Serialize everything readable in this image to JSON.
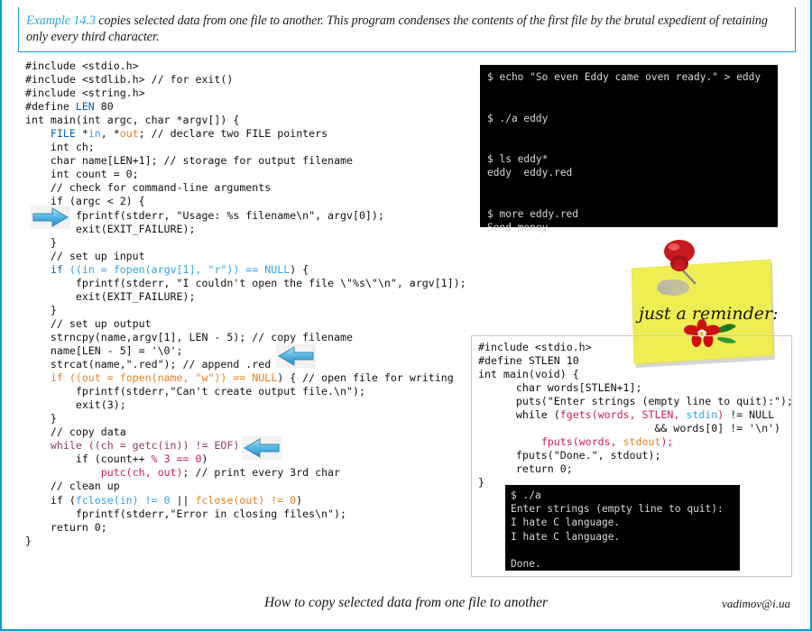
{
  "header": {
    "example_label": "Example 14.3",
    "body_text": " copies selected data from one file to another. This program condenses the contents of the first file by the brutal expedient of retaining only every third character."
  },
  "code_main": {
    "lines": [
      [
        {
          "t": "#include <stdio.h>",
          "c": "plain"
        }
      ],
      [
        {
          "t": "#include <stdlib.h> ",
          "c": "plain"
        },
        {
          "t": "// for exit()",
          "c": "plain"
        }
      ],
      [
        {
          "t": "#include <string.h>",
          "c": "plain"
        }
      ],
      [
        {
          "t": "#define ",
          "c": "plain"
        },
        {
          "t": "LEN",
          "c": "key"
        },
        {
          "t": " 80",
          "c": "plain"
        }
      ],
      [
        {
          "t": "int main(int argc, char *argv[]) {",
          "c": "plain"
        }
      ],
      [
        {
          "t": "    ",
          "c": "plain"
        },
        {
          "t": "FILE",
          "c": "key"
        },
        {
          "t": " *",
          "c": "plain"
        },
        {
          "t": "in",
          "c": "lblue"
        },
        {
          "t": ", *",
          "c": "plain"
        },
        {
          "t": "out",
          "c": "orange"
        },
        {
          "t": "; // declare two FILE pointers",
          "c": "plain"
        }
      ],
      [
        {
          "t": "    int ch;",
          "c": "plain"
        }
      ],
      [
        {
          "t": "    char name[LEN+1]; // storage for output filename",
          "c": "plain"
        }
      ],
      [
        {
          "t": "    int count = 0;",
          "c": "plain"
        }
      ],
      [
        {
          "t": "    // check for command-line arguments",
          "c": "plain"
        }
      ],
      [
        {
          "t": "    if (argc < 2) {",
          "c": "plain"
        }
      ],
      [
        {
          "t": "        fprintf(stderr, \"Usage: %s filename\\n\", argv[0]);",
          "c": "plain"
        }
      ],
      [
        {
          "t": "        exit(EXIT_FAILURE);",
          "c": "plain"
        }
      ],
      [
        {
          "t": "    }",
          "c": "plain"
        }
      ],
      [
        {
          "t": "    // set up input",
          "c": "plain"
        }
      ],
      [
        {
          "t": "    ",
          "c": "plain"
        },
        {
          "t": "if",
          "c": "key"
        },
        {
          "t": " ((",
          "c": "lblue"
        },
        {
          "t": "in",
          "c": "lblue"
        },
        {
          "t": " = ",
          "c": "lblue"
        },
        {
          "t": "fopen(argv[1], \"r\")) == NULL",
          "c": "lblue"
        },
        {
          "t": ") {",
          "c": "plain"
        }
      ],
      [
        {
          "t": "        fprintf(stderr, \"I couldn't open the file \\\"%s\\\"\\n\", argv[1]);",
          "c": "plain"
        }
      ],
      [
        {
          "t": "        exit(EXIT_FAILURE);",
          "c": "plain"
        }
      ],
      [
        {
          "t": "    }",
          "c": "plain"
        }
      ],
      [
        {
          "t": "    // set up output",
          "c": "plain"
        }
      ],
      [
        {
          "t": "    strncpy(name,argv[1], LEN - 5); // copy filename",
          "c": "plain"
        }
      ],
      [
        {
          "t": "    name[LEN - 5] = '\\0';",
          "c": "plain"
        }
      ],
      [
        {
          "t": "    strcat(name,\".red\"); // append .red",
          "c": "plain"
        }
      ],
      [
        {
          "t": "    ",
          "c": "plain"
        },
        {
          "t": "if ((",
          "c": "orange"
        },
        {
          "t": "out",
          "c": "orange"
        },
        {
          "t": " = fopen(name, \"w\")) == NULL",
          "c": "orange"
        },
        {
          "t": ") { // open file for writing",
          "c": "plain"
        }
      ],
      [
        {
          "t": "        fprintf(stderr,\"Can't create output file.\\n\");",
          "c": "plain"
        }
      ],
      [
        {
          "t": "        exit(3);",
          "c": "plain"
        }
      ],
      [
        {
          "t": "    }",
          "c": "plain"
        }
      ],
      [
        {
          "t": "    // copy data",
          "c": "plain"
        }
      ],
      [
        {
          "t": "    ",
          "c": "plain"
        },
        {
          "t": "while ((ch = getc(in)) != EOF)",
          "c": "purple"
        }
      ],
      [
        {
          "t": "        if (count++ ",
          "c": "plain"
        },
        {
          "t": "% 3 == 0",
          "c": "pink"
        },
        {
          "t": ")",
          "c": "plain"
        }
      ],
      [
        {
          "t": "            ",
          "c": "plain"
        },
        {
          "t": "putc(ch, out)",
          "c": "pink"
        },
        {
          "t": "; // print every 3rd char",
          "c": "plain"
        }
      ],
      [
        {
          "t": "    // clean up",
          "c": "plain"
        }
      ],
      [
        {
          "t": "    if (",
          "c": "plain"
        },
        {
          "t": "fclose(in) != 0",
          "c": "lblue"
        },
        {
          "t": " || ",
          "c": "plain"
        },
        {
          "t": "fclose(out) != 0",
          "c": "orange"
        },
        {
          "t": ")",
          "c": "plain"
        }
      ],
      [
        {
          "t": "        fprintf(stderr,\"Error in closing files\\n\");",
          "c": "plain"
        }
      ],
      [
        {
          "t": "    return 0;",
          "c": "plain"
        }
      ],
      [
        {
          "t": "}",
          "c": "plain"
        }
      ]
    ]
  },
  "terminal_1": {
    "lines": [
      "$ echo \"So even Eddy came oven ready.\" > eddy",
      "",
      "",
      "$ ./a eddy",
      "",
      "",
      "$ ls eddy*",
      "eddy  eddy.red",
      "",
      "",
      "$ more eddy.red",
      "Send money"
    ]
  },
  "sticky_note": {
    "text": "just a reminder:"
  },
  "code_2": {
    "lines": [
      [
        {
          "t": "#include <stdio.h>",
          "c": "plain"
        }
      ],
      [
        {
          "t": "#define STLEN 10",
          "c": "plain"
        }
      ],
      [
        {
          "t": "int main(void) {",
          "c": "plain"
        }
      ],
      [
        {
          "t": "      char words[STLEN+1];",
          "c": "plain"
        }
      ],
      [
        {
          "t": "      puts(\"Enter strings (empty line to quit):\");",
          "c": "plain"
        }
      ],
      [
        {
          "t": "      while (",
          "c": "plain"
        },
        {
          "t": "fgets(words, STLEN, ",
          "c": "pink"
        },
        {
          "t": "stdin",
          "c": "lblue"
        },
        {
          "t": ")",
          "c": "pink"
        },
        {
          "t": " != NULL",
          "c": "plain"
        }
      ],
      [
        {
          "t": "                            && words[0] != '\\n')",
          "c": "plain"
        }
      ],
      [
        {
          "t": "          ",
          "c": "plain"
        },
        {
          "t": "fputs(words, ",
          "c": "pink"
        },
        {
          "t": "stdout",
          "c": "orange"
        },
        {
          "t": ");",
          "c": "pink"
        }
      ],
      [
        {
          "t": "      fputs(\"Done.\", stdout);",
          "c": "plain"
        }
      ],
      [
        {
          "t": "      return 0;",
          "c": "plain"
        }
      ],
      [
        {
          "t": "}",
          "c": "plain"
        }
      ]
    ]
  },
  "terminal_2": {
    "lines": [
      "$ ./a",
      "Enter strings (empty line to quit):",
      "I hate C language.",
      "I hate C language.",
      "",
      "Done."
    ]
  },
  "footer": {
    "title": "How to copy selected data from one file to another",
    "email": "vadimov@i.ua"
  },
  "colors": {
    "accent": "#0d9ad7",
    "example_label": "#2fa8dd",
    "terminal_bg": "#000000",
    "terminal_fg": "#d8d8d8",
    "note_yellow": "#ecea4e",
    "pin_red": "#c8191e"
  }
}
